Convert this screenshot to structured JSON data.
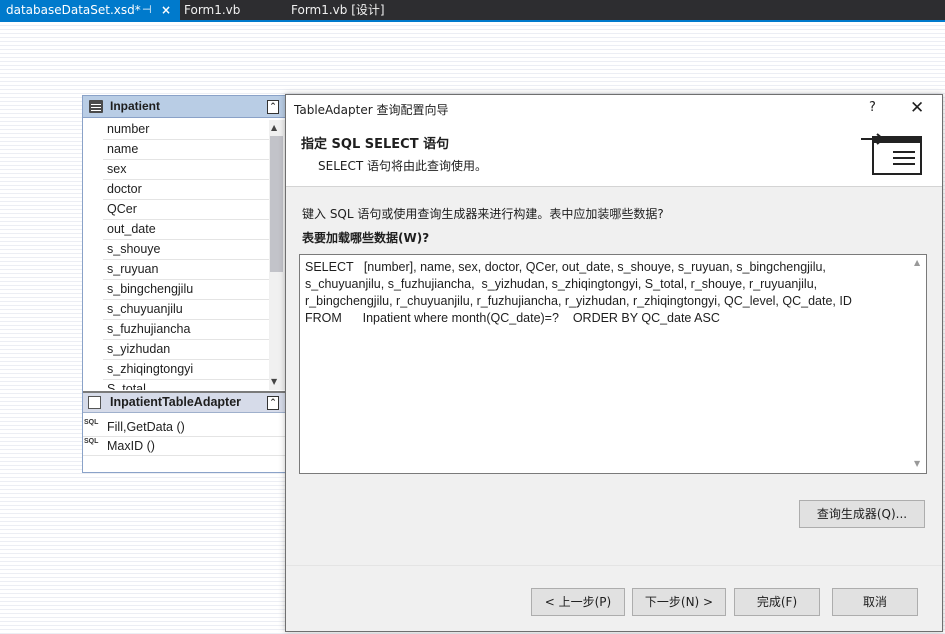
{
  "tabs": [
    {
      "label": "databaseDataSet.xsd*",
      "pin": "⊣",
      "close": "×"
    },
    {
      "label": "Form1.vb"
    },
    {
      "label": "Form1.vb [设计]"
    }
  ],
  "colors": {
    "accent": "#007acc",
    "tab_bar": "#2d2d30",
    "table_header": "#b9cde5"
  },
  "datatable": {
    "title": "Inpatient",
    "columns": [
      "number",
      "name",
      "sex",
      "doctor",
      "QCer",
      "out_date",
      "s_shouye",
      "s_ruyuan",
      "s_bingchengjilu",
      "s_chuyuanjilu",
      "s_fuzhujiancha",
      "s_yizhudan",
      "s_zhiqingtongyi",
      "S_total"
    ],
    "adapter": {
      "title": "InpatientTableAdapter",
      "methods": [
        "Fill,GetData ()",
        "MaxID ()"
      ],
      "sql_icon": "SQL"
    }
  },
  "dialog": {
    "title": "TableAdapter 查询配置向导",
    "help": "?",
    "close": "✕",
    "heading": "指定 SQL  SELECT 语句",
    "subheading": "SELECT 语句将由此查询使用。",
    "instruction": "键入 SQL 语句或使用查询生成器来进行构建。表中应加装哪些数据?",
    "prompt": "表要加载哪些数据(W)?",
    "sql_lines": [
      "SELECT   [number], name, sex, doctor, QCer, out_date, s_shouye, s_ruyuan, s_bingchengjilu,",
      "s_chuyuanjilu, s_fuzhujiancha,  s_yizhudan, s_zhiqingtongyi, S_total, r_shouye, r_ruyuanjilu,",
      "r_bingchengjilu, r_chuyuanjilu, r_fuzhujiancha, r_yizhudan, r_zhiqingtongyi, QC_level, QC_date, ID",
      "FROM      Inpatient where month(QC_date)=?    ORDER BY QC_date ASC"
    ],
    "buttons": {
      "query_builder": "查询生成器(Q)...",
      "back": "< 上一步(P)",
      "next": "下一步(N) >",
      "finish": "完成(F)",
      "cancel": "取消"
    }
  }
}
